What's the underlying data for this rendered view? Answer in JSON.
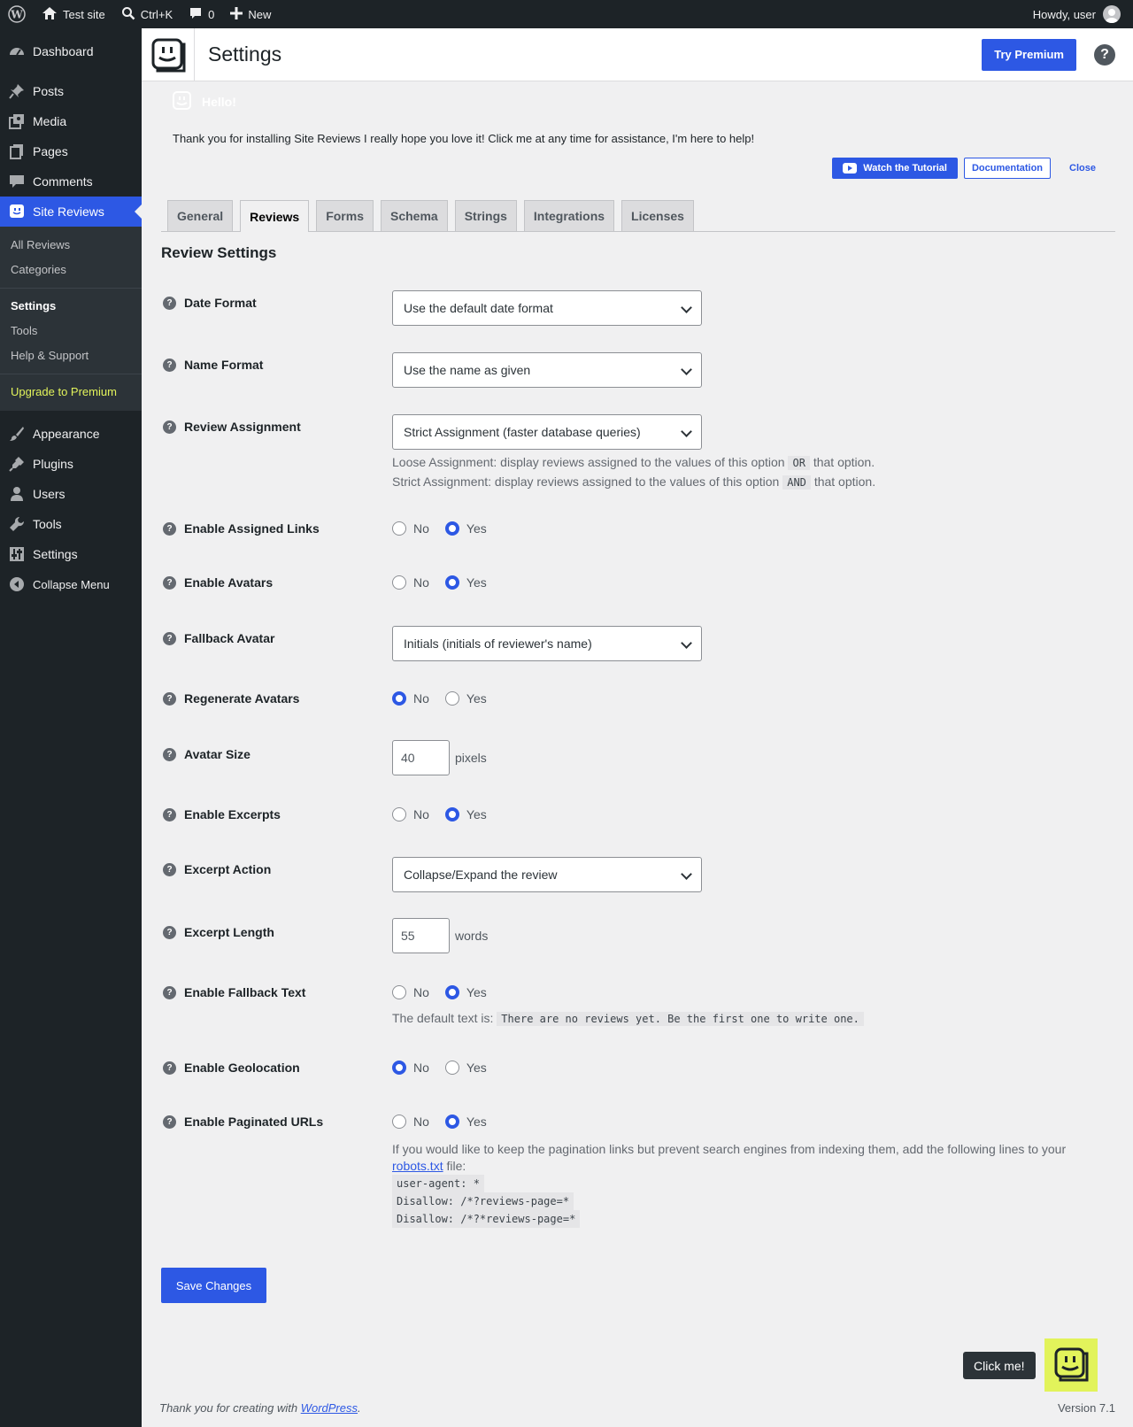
{
  "adminbar": {
    "site_name": "Test site",
    "search_shortcut": "Ctrl+K",
    "comments_count": "0",
    "new_label": "New",
    "howdy": "Howdy, user"
  },
  "sidebar": {
    "dashboard": "Dashboard",
    "posts": "Posts",
    "media": "Media",
    "pages": "Pages",
    "comments": "Comments",
    "site_reviews": "Site Reviews",
    "sub": {
      "all_reviews": "All Reviews",
      "categories": "Categories",
      "settings": "Settings",
      "tools": "Tools",
      "help": "Help & Support",
      "upgrade": "Upgrade to Premium"
    },
    "appearance": "Appearance",
    "plugins": "Plugins",
    "users": "Users",
    "tools": "Tools",
    "settings": "Settings",
    "collapse": "Collapse Menu",
    "active_color": "#2d58e4"
  },
  "header": {
    "title": "Settings",
    "try_premium": "Try Premium"
  },
  "notice": {
    "hello": "Hello!",
    "text": "Thank you for installing Site Reviews I really hope you love it! Click me at any time for assistance, I'm here to help!",
    "watch": "Watch the Tutorial",
    "docs": "Documentation",
    "close": "Close"
  },
  "tabs": [
    "General",
    "Reviews",
    "Forms",
    "Schema",
    "Strings",
    "Integrations",
    "Licenses"
  ],
  "settings": {
    "section_title": "Review Settings",
    "date_format": {
      "label": "Date Format",
      "value": "Use the default date format"
    },
    "name_format": {
      "label": "Name Format",
      "value": "Use the name as given"
    },
    "review_assignment": {
      "label": "Review Assignment",
      "value": "Strict Assignment (faster database queries)",
      "desc1_pre": "Loose Assignment: display reviews assigned to the values of this option",
      "desc1_code": "OR",
      "desc1_post": "that option.",
      "desc2_pre": "Strict Assignment: display reviews assigned to the values of this option",
      "desc2_code": "AND",
      "desc2_post": "that option."
    },
    "assigned_links": {
      "label": "Enable Assigned Links"
    },
    "avatars": {
      "label": "Enable Avatars"
    },
    "fallback_avatar": {
      "label": "Fallback Avatar",
      "value": "Initials (initials of reviewer's name)"
    },
    "regenerate_avatars": {
      "label": "Regenerate Avatars"
    },
    "avatar_size": {
      "label": "Avatar Size",
      "value": "40",
      "unit": "pixels"
    },
    "excerpts": {
      "label": "Enable Excerpts"
    },
    "excerpt_action": {
      "label": "Excerpt Action",
      "value": "Collapse/Expand the review"
    },
    "excerpt_length": {
      "label": "Excerpt Length",
      "value": "55",
      "unit": "words"
    },
    "fallback_text": {
      "label": "Enable Fallback Text",
      "desc_pre": "The default text is:",
      "desc_code": "There are no reviews yet. Be the first one to write one."
    },
    "geolocation": {
      "label": "Enable Geolocation"
    },
    "paginated_urls": {
      "label": "Enable Paginated URLs",
      "desc_pre": "If you would like to keep the pagination links but prevent search engines from indexing them, add the following lines to your",
      "desc_link": "robots.txt",
      "desc_post": "file:",
      "code1": "user-agent: *",
      "code2": "Disallow: /*?reviews-page=*",
      "code3": "Disallow: /*?*reviews-page=*"
    },
    "no": "No",
    "yes": "Yes",
    "save": "Save Changes"
  },
  "assistant": {
    "click_me": "Click me!"
  },
  "footer": {
    "thanks_pre": "Thank you for creating with",
    "thanks_link": "WordPress",
    "thanks_post": ".",
    "version": "Version 7.1"
  }
}
